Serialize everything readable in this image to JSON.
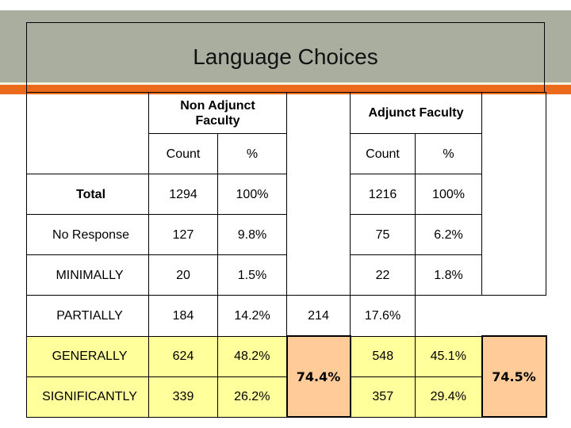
{
  "slide": {
    "title": "Language Choices",
    "colors": {
      "title_band": "#a9ae9f",
      "accent_band": "#ec6a1c",
      "highlight_row": "#ffff9c",
      "summary_cell": "#ffcc99"
    }
  },
  "table": {
    "group_headers": {
      "non_adjunct": "Non Adjunct Faculty",
      "adjunct": "Adjunct Faculty"
    },
    "sub_headers": {
      "count": "Count",
      "percent": "%"
    },
    "rows": [
      {
        "label": "Total",
        "na_count": "1294",
        "na_pct": "100%",
        "adj_count": "1216",
        "adj_pct": "100%"
      },
      {
        "label": "No Response",
        "na_count": "127",
        "na_pct": "9.8%",
        "adj_count": "75",
        "adj_pct": "6.2%"
      },
      {
        "label": "MINIMALLY",
        "na_count": "20",
        "na_pct": "1.5%",
        "adj_count": "22",
        "adj_pct": "1.8%"
      },
      {
        "label": "PARTIALLY",
        "na_count": "184",
        "na_pct": "14.2%",
        "adj_count": "214",
        "adj_pct": "17.6%"
      },
      {
        "label": "GENERALLY",
        "na_count": "624",
        "na_pct": "48.2%",
        "adj_count": "548",
        "adj_pct": "45.1%"
      },
      {
        "label": "SIGNIFICANTLY",
        "na_count": "339",
        "na_pct": "26.2%",
        "adj_count": "357",
        "adj_pct": "29.4%"
      }
    ],
    "summary": {
      "non_adjunct_generally_plus_significantly": "74.4%",
      "adjunct_generally_plus_significantly": "74.5%"
    }
  }
}
